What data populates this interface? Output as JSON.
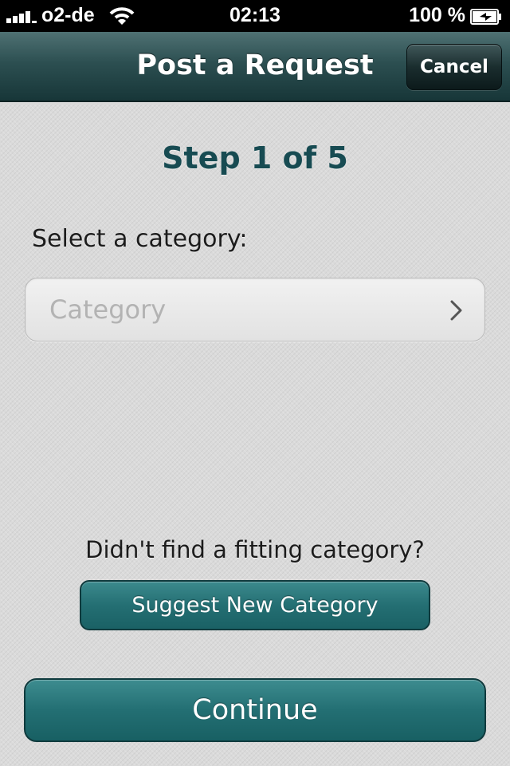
{
  "status_bar": {
    "carrier": "o2-de",
    "time": "02:13",
    "battery": "100 %",
    "signal_icon": "signal-bars-icon",
    "wifi_icon": "wifi-icon",
    "battery_icon": "battery-charging-icon"
  },
  "navbar": {
    "title": "Post a Request",
    "cancel_label": "Cancel"
  },
  "main": {
    "step": "Step 1 of 5",
    "select_label": "Select a category:",
    "category_placeholder": "Category",
    "chevron_icon": "chevron-right-icon",
    "not_found_text": "Didn't find a fitting category?",
    "suggest_label": "Suggest New Category",
    "continue_label": "Continue"
  },
  "colors": {
    "accent": "#246f73",
    "title_teal": "#174b52",
    "navbar_dark": "#173638"
  }
}
